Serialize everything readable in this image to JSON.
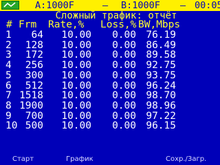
{
  "status_bar": {
    "port_a": "A:1000F",
    "separator_1": "–",
    "port_b": "B:1000F",
    "separator_2": "–",
    "clock": "00:05"
  },
  "report": {
    "title": "Сложный трафик: отчёт",
    "columns": [
      "#",
      "Frm",
      "Rate,%",
      "Loss,%",
      "BW,Mbps"
    ],
    "rows": [
      {
        "num": "1",
        "frm": "64",
        "rate": "10.00",
        "loss": "0.00",
        "bw": "76.19"
      },
      {
        "num": "2",
        "frm": "128",
        "rate": "10.00",
        "loss": "0.00",
        "bw": "86.49"
      },
      {
        "num": "3",
        "frm": "172",
        "rate": "10.00",
        "loss": "0.00",
        "bw": "89.58"
      },
      {
        "num": "4",
        "frm": "256",
        "rate": "10.00",
        "loss": "0.00",
        "bw": "92.75"
      },
      {
        "num": "5",
        "frm": "300",
        "rate": "10.00",
        "loss": "0.00",
        "bw": "93.75"
      },
      {
        "num": "6",
        "frm": "512",
        "rate": "10.00",
        "loss": "0.00",
        "bw": "96.24"
      },
      {
        "num": "7",
        "frm": "1518",
        "rate": "10.00",
        "loss": "0.00",
        "bw": "98.70"
      },
      {
        "num": "8",
        "frm": "1900",
        "rate": "10.00",
        "loss": "0.00",
        "bw": "98.96"
      },
      {
        "num": "9",
        "frm": "700",
        "rate": "10.00",
        "loss": "0.00",
        "bw": "97.22"
      },
      {
        "num": "10",
        "frm": "500",
        "rate": "10.00",
        "loss": "0.00",
        "bw": "96.15"
      }
    ]
  },
  "function_keys": {
    "f1": "Старт",
    "f2": "График",
    "f3": "Сохр./Загр."
  },
  "colors": {
    "background": "#0000b8",
    "status_bar": "#fff000",
    "header_text": "#ffff30",
    "row_text": "#ffffff"
  },
  "icons": {
    "status_logo": "signal-logo-icon"
  }
}
